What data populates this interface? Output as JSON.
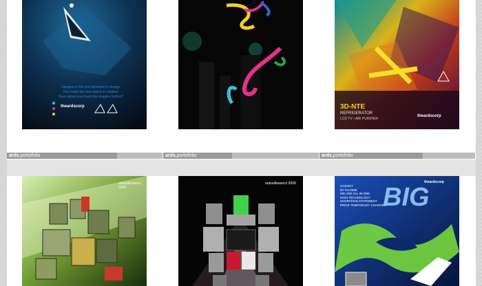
{
  "portfolio": {
    "brand": "ards.",
    "section": "portofolio"
  },
  "poster1": {
    "tagline": [
      "Imagine is the one important in design",
      "it to make the new space in creative",
      "Have about you found the imagine before?"
    ],
    "logo": "theardscorp"
  },
  "poster3": {
    "headline": "3D-NTE",
    "product": "REFRIGERATOR",
    "subline": "LCD TV • AIR PURIFIER",
    "logo": "theardscorp"
  },
  "poster4": {
    "caption": "ardsuitleaseco 2009"
  },
  "poster5": {
    "caption": "ardsuitleaseco 2009"
  },
  "poster6": {
    "lines": [
      "GADGET",
      "BY ECOMM",
      "WE ARE ALL IN ONE",
      "HIGH TECHNOLOGY",
      "SHOPATION STATEMENT",
      "PRICE TEMPORARY CHANGES"
    ],
    "headline": "BIG",
    "logo": "theardscorp"
  },
  "colors": {
    "footer_bg": "#9a9a9a",
    "accent_cyan": "#2ec4d8",
    "accent_magenta": "#e0338d",
    "accent_yellow": "#f2d022"
  }
}
